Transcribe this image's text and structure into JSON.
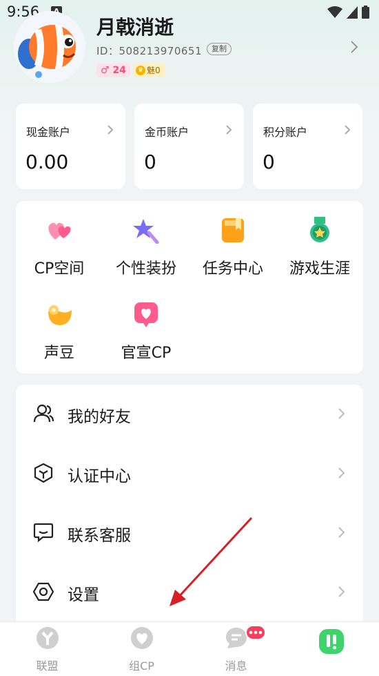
{
  "status_bar": {
    "time": "9:56",
    "notification_icon": "A"
  },
  "profile": {
    "name": "月戟消逝",
    "id_text": "ID：508213970651",
    "copy_label": "复制",
    "level": "24",
    "charm_label": "魅0"
  },
  "accounts": [
    {
      "title": "现金账户",
      "value": "0.00"
    },
    {
      "title": "金币账户",
      "value": "0"
    },
    {
      "title": "积分账户",
      "value": "0"
    }
  ],
  "features": [
    {
      "label": "CP空间",
      "icon": "hearts-icon"
    },
    {
      "label": "个性装扮",
      "icon": "star-wand-icon"
    },
    {
      "label": "任务中心",
      "icon": "clipboard-icon"
    },
    {
      "label": "游戏生涯",
      "icon": "medal-icon"
    },
    {
      "label": "声豆",
      "icon": "bean-icon"
    },
    {
      "label": "官宣CP",
      "icon": "heart-card-icon"
    }
  ],
  "menu": [
    {
      "label": "我的好友",
      "icon": "friends-icon"
    },
    {
      "label": "认证中心",
      "icon": "shield-icon"
    },
    {
      "label": "联系客服",
      "icon": "chat-icon"
    },
    {
      "label": "设置",
      "icon": "gear-icon"
    }
  ],
  "nav": [
    {
      "label": "联盟",
      "icon": "alliance-icon"
    },
    {
      "label": "组CP",
      "icon": "heart-icon"
    },
    {
      "label": "消息",
      "icon": "message-icon"
    },
    {
      "label": "",
      "icon": "profile-icon"
    }
  ],
  "colors": {
    "accent_green": "#3ed36b",
    "level_pink": "#ff4d7a",
    "badge_red": "#f43f5e",
    "annotation_red": "#d61f26"
  }
}
